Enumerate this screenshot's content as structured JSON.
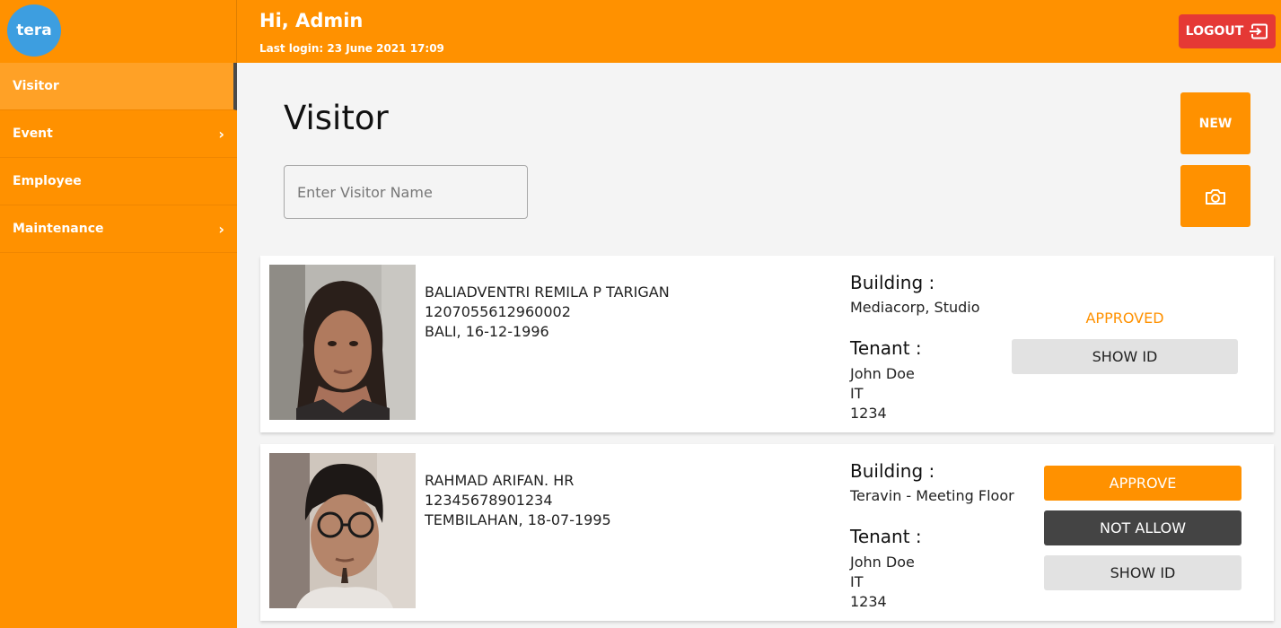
{
  "brand": {
    "logo_text": "tera"
  },
  "header": {
    "greeting": "Hi, Admin",
    "last_login": "Last login: 23 June 2021 17:09",
    "logout_label": "LOGOUT"
  },
  "sidebar": {
    "items": [
      {
        "label": "Visitor",
        "active": true,
        "has_submenu": false
      },
      {
        "label": "Event",
        "active": false,
        "has_submenu": true
      },
      {
        "label": "Employee",
        "active": false,
        "has_submenu": false
      },
      {
        "label": "Maintenance",
        "active": false,
        "has_submenu": true
      }
    ],
    "chevron": "›"
  },
  "page": {
    "title": "Visitor",
    "search_placeholder": "Enter Visitor Name",
    "new_label": "NEW",
    "camera_icon": "camera-icon"
  },
  "visitors": [
    {
      "name": "BALIADVENTRI REMILA P TARIGAN",
      "id_number": "1207055612960002",
      "birth": "BALI, 16-12-1996",
      "building_label": "Building :",
      "building": "Mediacorp, Studio",
      "tenant_label": "Tenant :",
      "tenant_name": "John Doe",
      "tenant_dept": "IT",
      "tenant_ext": "1234",
      "status": "APPROVED",
      "show_id_label": "SHOW ID"
    },
    {
      "name": "RAHMAD ARIFAN. HR",
      "id_number": "12345678901234",
      "birth": "TEMBILAHAN, 18-07-1995",
      "building_label": "Building :",
      "building": "Teravin - Meeting Floor",
      "tenant_label": "Tenant :",
      "tenant_name": "John Doe",
      "tenant_dept": "IT",
      "tenant_ext": "1234",
      "approve_label": "APPROVE",
      "not_allow_label": "NOT ALLOW",
      "show_id_label": "SHOW ID"
    }
  ],
  "colors": {
    "primary": "#ff9100",
    "logout": "#e53935",
    "logo": "#3d9ee0",
    "deny": "#444444",
    "neutral_button": "#e2e2e2"
  }
}
